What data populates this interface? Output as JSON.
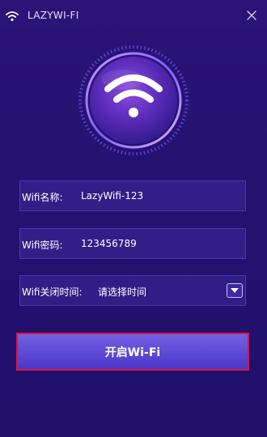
{
  "app": {
    "title": "LAZYWI-FI"
  },
  "icons": {
    "titlebar": "wifi-icon",
    "close": "close-icon",
    "hero": "wifi-icon",
    "dropdown": "chevron-down-icon"
  },
  "colors": {
    "background_top": "#2a1478",
    "background_bottom": "#20106a",
    "field_border": "#4a3aa9",
    "button_top": "#7260e4",
    "button_bottom": "#4c36c8",
    "highlight_border": "#e2123b",
    "ring_accent": "#a779ff"
  },
  "form": {
    "ssid": {
      "label": "Wifi名称:",
      "value": "LazyWifi-123"
    },
    "password": {
      "label": "Wifi密码:",
      "value": "123456789"
    },
    "close_time": {
      "label": "Wifi关闭时间:",
      "value": "请选择时间"
    }
  },
  "action": {
    "start_label": "开启Wi-Fi"
  }
}
